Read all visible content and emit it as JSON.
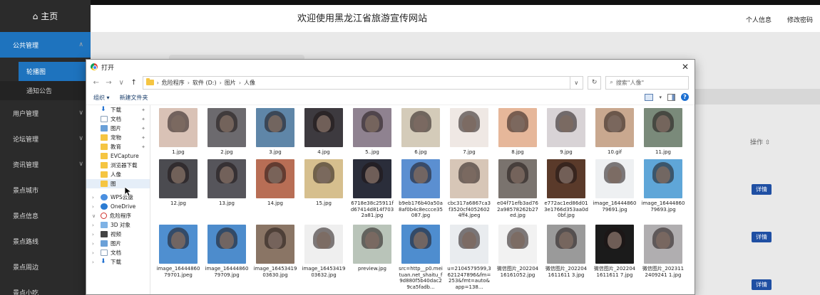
{
  "sidebar": {
    "home_label": "主页",
    "items": [
      {
        "label": "公共管理",
        "active": true,
        "expanded": true
      },
      {
        "label": "用户管理"
      },
      {
        "label": "论坛管理"
      },
      {
        "label": "资讯管理"
      },
      {
        "label": "景点城市"
      },
      {
        "label": "景点信息"
      },
      {
        "label": "景点路线"
      },
      {
        "label": "景点周边"
      },
      {
        "label": "景点小吃"
      }
    ],
    "sub_items": [
      {
        "label": "轮播图",
        "active": true
      },
      {
        "label": "通知公告"
      }
    ]
  },
  "topbar": {
    "title": "欢迎使用黑龙江省旅游宣传网站",
    "links": [
      "个人信息",
      "修改密码"
    ]
  },
  "content": {
    "op_header": "操作 ⇳",
    "detail_label": "详情"
  },
  "dialog": {
    "title": "打开",
    "path": [
      "危险程序",
      "软件 (D:)",
      "图片",
      "人像"
    ],
    "search_placeholder": "搜索\"人像\"",
    "organize_label": "组织 ▾",
    "new_folder_label": "新建文件夹",
    "nav_items": [
      {
        "label": "下载",
        "icon": "download-icon",
        "pinned": true
      },
      {
        "label": "文档",
        "icon": "document-icon",
        "pinned": true
      },
      {
        "label": "图片",
        "icon": "pictures-icon",
        "pinned": true
      },
      {
        "label": "宠物",
        "icon": "folder-icon",
        "pinned": true
      },
      {
        "label": "教育",
        "icon": "folder-icon",
        "pinned": true
      },
      {
        "label": "EVCapture",
        "icon": "folder-icon"
      },
      {
        "label": "浏览器下载",
        "icon": "folder-icon"
      },
      {
        "label": "人像",
        "icon": "folder-icon"
      },
      {
        "label": "图",
        "icon": "folder-icon",
        "selected": true
      },
      {
        "label": "WPS云盘",
        "icon": "cloud-icon",
        "group": true
      },
      {
        "label": "OneDrive",
        "icon": "onedrive-icon",
        "group": true
      },
      {
        "label": "危险程序",
        "icon": "forbidden-icon",
        "group": true,
        "expanded": true
      },
      {
        "label": "3D 对象",
        "icon": "3d-objects-icon",
        "child": true
      },
      {
        "label": "视频",
        "icon": "video-icon",
        "child": true
      },
      {
        "label": "图片",
        "icon": "pictures-icon",
        "child": true
      },
      {
        "label": "文档",
        "icon": "document-icon",
        "child": true
      },
      {
        "label": "下载",
        "icon": "download-icon",
        "child": true
      }
    ],
    "files": [
      {
        "name": "1.jpg",
        "color": "#d9c2b6"
      },
      {
        "name": "2.jpg",
        "color": "#6c6a6e"
      },
      {
        "name": "3.jpg",
        "color": "#5f86a8"
      },
      {
        "name": "4.jpg",
        "color": "#3d3a3f"
      },
      {
        "name": "5..jpg",
        "color": "#8f8290"
      },
      {
        "name": "6.jpg",
        "color": "#d4cbb9"
      },
      {
        "name": "7.jpg",
        "color": "#efe8e4"
      },
      {
        "name": "8.jpg",
        "color": "#e6b79a"
      },
      {
        "name": "9.jpg",
        "color": "#d8d3d6"
      },
      {
        "name": "10.gif",
        "color": "#c9a88f"
      },
      {
        "name": "11.jpg",
        "color": "#7a8a7a"
      },
      {
        "name": "12.jpg",
        "color": "#4b4b50"
      },
      {
        "name": "13.jpg",
        "color": "#56555b"
      },
      {
        "name": "14.jpg",
        "color": "#b86e55"
      },
      {
        "name": "15.jpg",
        "color": "#d6bf8e"
      },
      {
        "name": "6718e38c25911fd67414d814f7032a81.jpg",
        "color": "#2a2d3a"
      },
      {
        "name": "b9eb176b40a50a8af0b4c8eccce35087.jpg",
        "color": "#5b8fd1"
      },
      {
        "name": "cbc317a6867ca3f3520cf40526024ff4.jpeg",
        "color": "#d7c6b7"
      },
      {
        "name": "e04f71efb3ad762a98578262b27ed.jpg",
        "color": "#7a736e"
      },
      {
        "name": "e772ac1ed86d013e1766d353aa0d0bf.jpg",
        "color": "#5a3a2a"
      },
      {
        "name": "image_1644486079691.jpg",
        "color": "#eef0f2"
      },
      {
        "name": "image_1644486079693.jpg",
        "color": "#5fa6d8"
      },
      {
        "name": "image_1644486079701.jpeg",
        "color": "#4f8fd0"
      },
      {
        "name": "image_1644486079709.jpg",
        "color": "#4d8ccc"
      },
      {
        "name": "image_1645341903630.jpg",
        "color": "#8a7565"
      },
      {
        "name": "image_1645341903632.jpg",
        "color": "#efefef"
      },
      {
        "name": "preview.jpg",
        "color": "#b9c4b9"
      },
      {
        "name": "src=http__p0.meituan.net_shaitu_f9d880f5b40dac29ca5fadb...",
        "color": "#4e8dcf"
      },
      {
        "name": "u=2104579599,3621247896&fm=253&fmt=auto&app=138...",
        "color": "#e9ecef"
      },
      {
        "name": "微信图片_20220416161052.jpg",
        "color": "#f2f2f2"
      },
      {
        "name": "微信图片_2022041611611 3.jpg",
        "color": "#9a9a9a"
      },
      {
        "name": "微信图片_2022041611611 7.jpg",
        "color": "#1b1b1b"
      },
      {
        "name": "微信图片_2023112409241 1.jpg",
        "color": "#b0aeb0"
      }
    ]
  }
}
